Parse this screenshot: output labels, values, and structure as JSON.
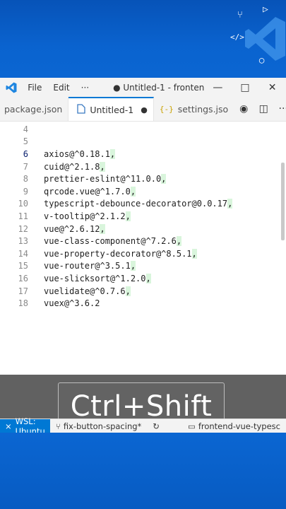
{
  "window": {
    "menu": [
      "File",
      "Edit",
      "···"
    ],
    "title": "● Untitled-1 - fronten..."
  },
  "tabs": [
    {
      "label": "package.json",
      "active": false
    },
    {
      "label": "Untitled-1",
      "active": true,
      "modified": true
    },
    {
      "label": "settings.jso",
      "active": false,
      "icon": "{-}"
    }
  ],
  "editor": {
    "current_line": 6,
    "lines": [
      {
        "num": "4",
        "text": ""
      },
      {
        "num": "5",
        "text": ""
      },
      {
        "num": "6",
        "text": "axios@^0.18.1",
        "tail": ","
      },
      {
        "num": "7",
        "text": "cuid@^2.1.8",
        "tail": ","
      },
      {
        "num": "8",
        "text": "prettier-eslint@^11.0.0",
        "tail": ","
      },
      {
        "num": "9",
        "text": "qrcode.vue@^1.7.0",
        "tail": ","
      },
      {
        "num": "10",
        "text": "typescript-debounce-decorator@0.0.17",
        "tail": ","
      },
      {
        "num": "11",
        "text": "v-tooltip@^2.1.2",
        "tail": ","
      },
      {
        "num": "12",
        "text": "vue@^2.6.12",
        "tail": ","
      },
      {
        "num": "13",
        "text": "vue-class-component@^7.2.6",
        "tail": ","
      },
      {
        "num": "14",
        "text": "vue-property-decorator@^8.5.1",
        "tail": ","
      },
      {
        "num": "15",
        "text": "vue-router@^3.5.1",
        "tail": ","
      },
      {
        "num": "16",
        "text": "vue-slicksort@^1.2.0",
        "tail": ","
      },
      {
        "num": "17",
        "text": "vuelidate@^0.7.6",
        "tail": ","
      },
      {
        "num": "18",
        "text": "vuex@^3.6.2",
        "tail": ""
      }
    ]
  },
  "keystroke_overlay": {
    "text": "Ctrl+Shift"
  },
  "statusbar": {
    "remote": "WSL: Ubuntu",
    "branch": "fix-button-spacing*",
    "folder": "frontend-vue-typesc"
  },
  "colors": {
    "accent": "#0078d4",
    "highlight": "#d9f5dc",
    "background": "#0a60c8"
  }
}
